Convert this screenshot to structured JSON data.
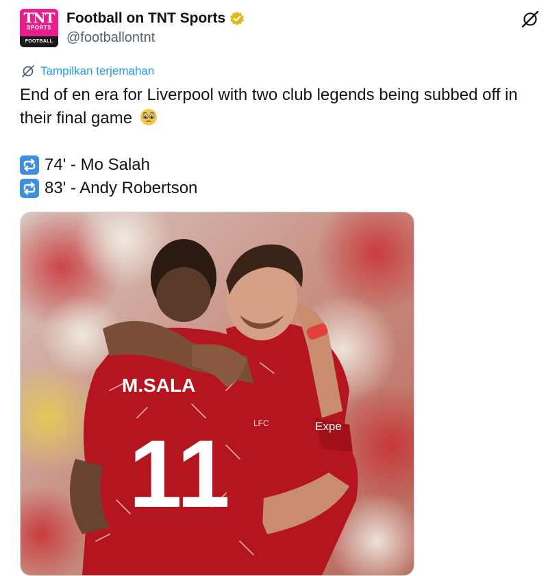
{
  "account": {
    "avatar": {
      "brand": "TNT",
      "brand_sub": "SPORTS",
      "section": "FOOTBALL"
    },
    "display_name": "Football on TNT Sports",
    "handle": "@footballontnt",
    "verified": true,
    "verified_color": "#e2b719"
  },
  "translate_label": "Tampilkan terjemahan",
  "tweet": {
    "text_line": "End of en era for Liverpool with two club legends being subbed off in their final game",
    "emoji": "pleading-face",
    "substitutions": [
      {
        "icon": "repeat-icon",
        "text": "74' - Mo Salah"
      },
      {
        "icon": "repeat-icon",
        "text": "83' - Andy Robertson"
      }
    ]
  },
  "media": {
    "description_in_image": {
      "left_player_shirt_name": "M.SALA",
      "left_player_shirt_number": "11",
      "right_player_sponsor": "Expe",
      "right_player_crest": "LFC"
    }
  },
  "colors": {
    "accent": "#1d9bf0",
    "brand_pink": "#e91e8c",
    "repeat_blue": "#3d8fe0",
    "shirt_red": "#b5151e"
  }
}
